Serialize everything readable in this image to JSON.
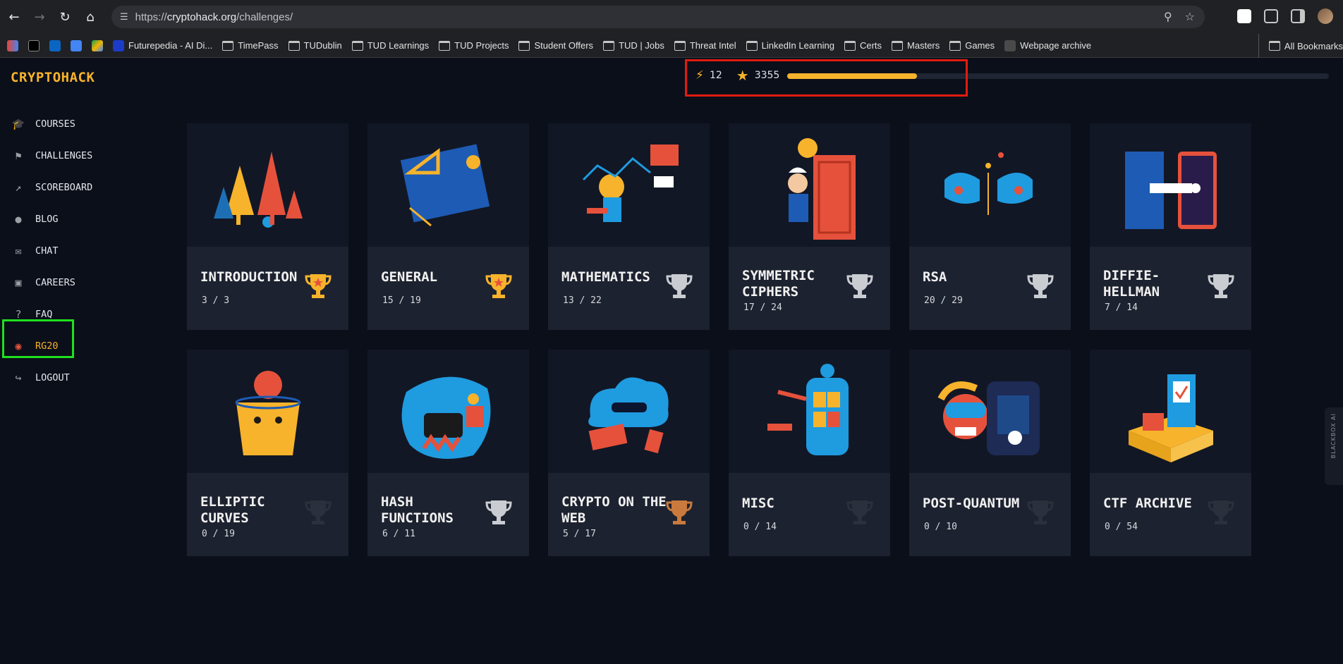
{
  "browser": {
    "url_prefix": "https://",
    "url_host": "cryptohack.org",
    "url_path": "/challenges/",
    "bookmarks": [
      "Futurepedia - AI Di...",
      "TimePass",
      "TUDublin",
      "TUD Learnings",
      "TUD Projects",
      "Student Offers",
      "TUD | Jobs",
      "Threat Intel",
      "LinkedIn Learning",
      "Certs",
      "Masters",
      "Games",
      "Webpage archive"
    ],
    "all_bookmarks": "All Bookmarks"
  },
  "app": {
    "logo": "CRYPTOHACK",
    "nav": [
      {
        "label": "COURSES",
        "icon": "graduation-cap-icon"
      },
      {
        "label": "CHALLENGES",
        "icon": "flag-icon"
      },
      {
        "label": "SCOREBOARD",
        "icon": "chart-line-icon"
      },
      {
        "label": "BLOG",
        "icon": "brain-icon"
      },
      {
        "label": "CHAT",
        "icon": "comments-icon"
      },
      {
        "label": "CAREERS",
        "icon": "briefcase-icon"
      },
      {
        "label": "FAQ",
        "icon": "question-icon"
      },
      {
        "label": "RG20",
        "icon": "user-circle-icon"
      },
      {
        "label": "LOGOUT",
        "icon": "sign-out-icon"
      }
    ],
    "stats": {
      "streak": "12",
      "score": "3355",
      "progress": 0.24
    },
    "side_widget": "BLACKBOX AI"
  },
  "categories": [
    {
      "title": "INTRODUCTION",
      "count": "3 / 3",
      "trophy": "gold",
      "art": "trees"
    },
    {
      "title": "GENERAL",
      "count": "15 / 19",
      "trophy": "gold",
      "art": "blueprint"
    },
    {
      "title": "MATHEMATICS",
      "count": "13 / 22",
      "trophy": "silver",
      "art": "math"
    },
    {
      "title": "SYMMETRIC CIPHERS",
      "count": "17 / 24",
      "trophy": "silver",
      "art": "door"
    },
    {
      "title": "RSA",
      "count": "20 / 29",
      "trophy": "silver",
      "art": "rsa"
    },
    {
      "title": "DIFFIE-HELLMAN",
      "count": "7 / 14",
      "trophy": "silver",
      "art": "handshake"
    },
    {
      "title": "ELLIPTIC CURVES",
      "count": "0 / 19",
      "trophy": "none",
      "art": "cup"
    },
    {
      "title": "HASH FUNCTIONS",
      "count": "6 / 11",
      "trophy": "silver",
      "art": "pot"
    },
    {
      "title": "CRYPTO ON THE WEB",
      "count": "5 / 17",
      "trophy": "bronze",
      "art": "cloud"
    },
    {
      "title": "MISC",
      "count": "0 / 14",
      "trophy": "none",
      "art": "robot"
    },
    {
      "title": "POST-QUANTUM",
      "count": "0 / 10",
      "trophy": "none",
      "art": "vr"
    },
    {
      "title": "CTF ARCHIVE",
      "count": "0 / 54",
      "trophy": "none",
      "art": "box"
    }
  ],
  "colors": {
    "accent": "#f7b32b",
    "bg": "#0b0f1a",
    "card": "#151a26",
    "gold": "#f7b32b",
    "silver": "#c9ccd1",
    "bronze": "#c97a3c",
    "none": "#2a303c"
  }
}
